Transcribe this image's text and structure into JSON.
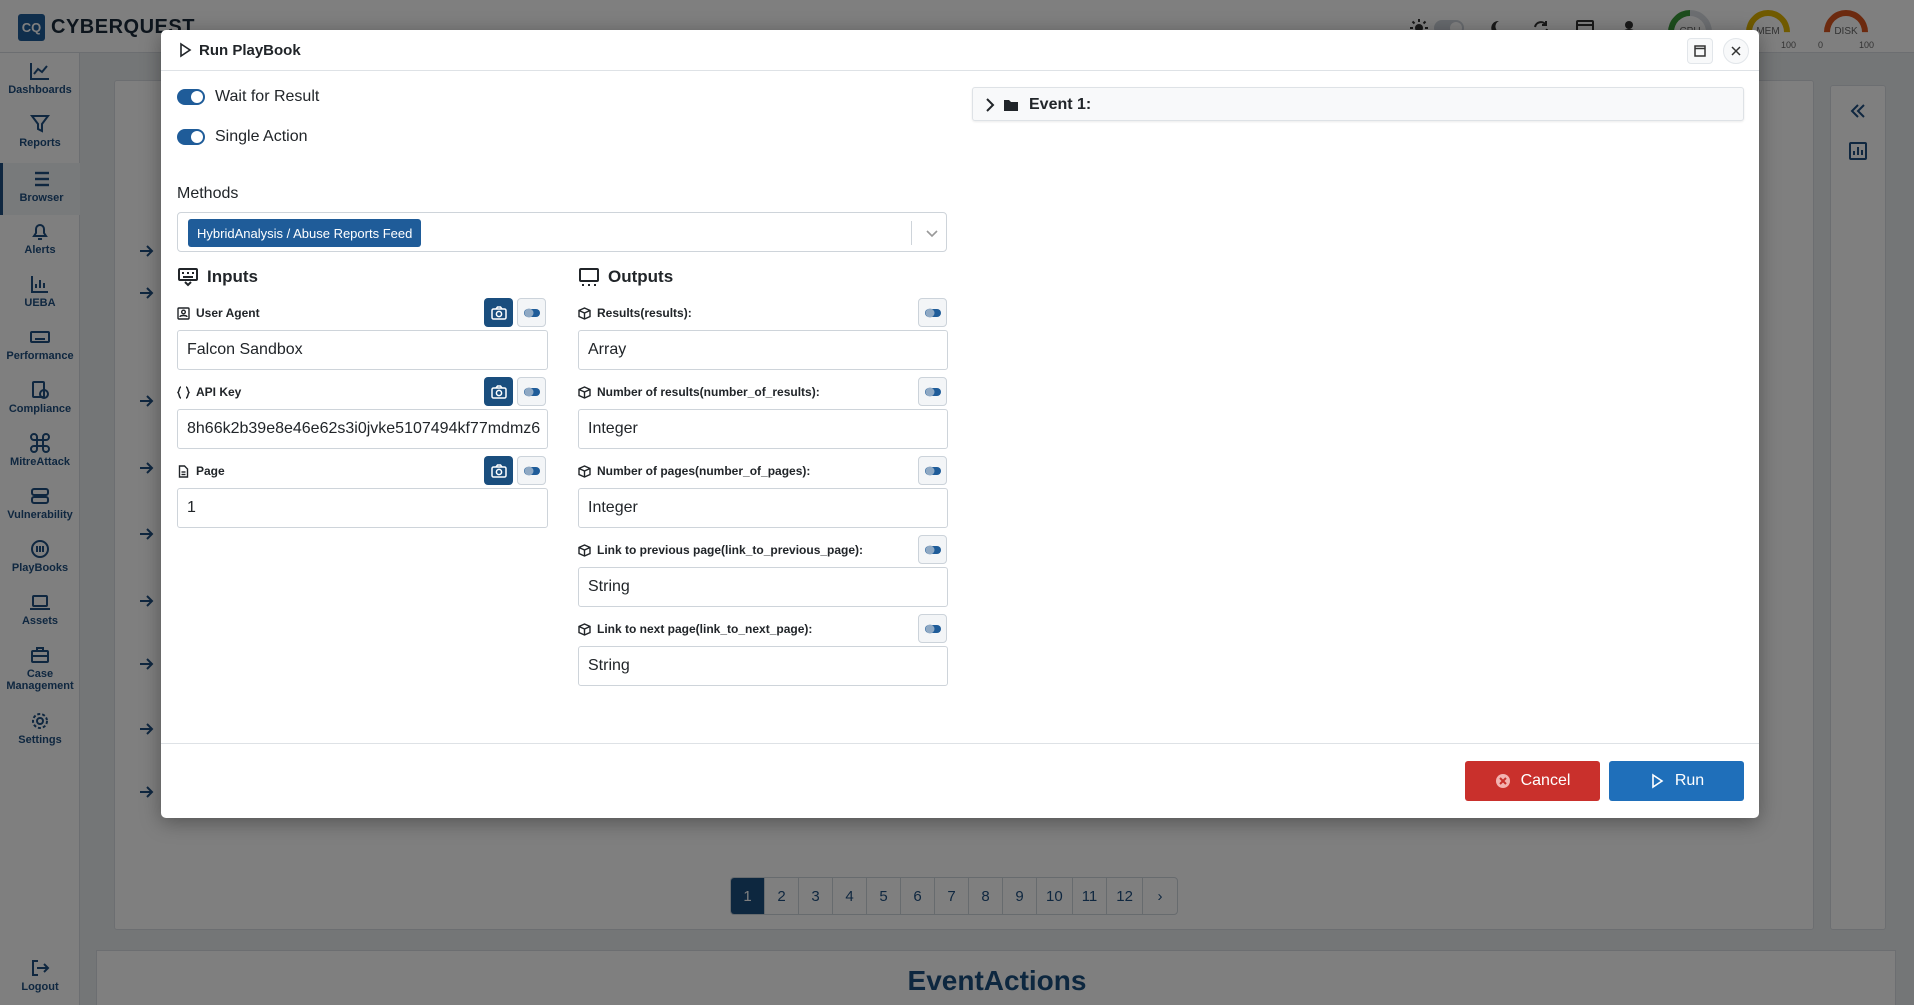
{
  "app": {
    "logo_mark": "CQ",
    "name": "CYBERQUEST"
  },
  "topbar": {
    "gauges": [
      {
        "label": "CPU",
        "min": "",
        "max": ""
      },
      {
        "label": "MEM",
        "min": "",
        "max": "100"
      },
      {
        "label": "DISK",
        "min": "0",
        "max": "100"
      }
    ]
  },
  "sidebar": {
    "items": [
      {
        "label": "Dashboards",
        "icon": "chart-line-icon"
      },
      {
        "label": "Reports",
        "icon": "filter-icon"
      },
      {
        "label": "Browser",
        "icon": "list-icon"
      },
      {
        "label": "Alerts",
        "icon": "bell-icon"
      },
      {
        "label": "UEBA",
        "icon": "chart-bar-icon"
      },
      {
        "label": "Performance",
        "icon": "keyboard-icon"
      },
      {
        "label": "Compliance",
        "icon": "file-check-icon"
      },
      {
        "label": "MitreAttack",
        "icon": "command-icon"
      },
      {
        "label": "Vulnerability",
        "icon": "server-icon"
      },
      {
        "label": "PlayBooks",
        "icon": "playbook-icon"
      },
      {
        "label": "Assets",
        "icon": "laptop-icon"
      },
      {
        "label": "Case",
        "label2": "Management",
        "icon": "briefcase-icon"
      },
      {
        "label": "Settings",
        "icon": "gear-icon"
      }
    ],
    "logout": "Logout"
  },
  "background": {
    "pagination": [
      "1",
      "2",
      "3",
      "4",
      "5",
      "6",
      "7",
      "8",
      "9",
      "10",
      "11",
      "12",
      "›"
    ],
    "bottom_title": "EventActions"
  },
  "modal": {
    "title": "Run PlayBook",
    "toggles": [
      {
        "label": "Wait for Result",
        "on": true
      },
      {
        "label": "Single Action",
        "on": true
      }
    ],
    "methods_label": "Methods",
    "methods_selected": "HybridAnalysis / Abuse Reports Feed",
    "inputs_title": "Inputs",
    "outputs_title": "Outputs",
    "inputs": [
      {
        "label": "User Agent",
        "value": "Falcon Sandbox"
      },
      {
        "label": "API Key",
        "value": "8h66k2b39e8e46e62s3i0jvke5107494kf77mdmz6"
      },
      {
        "label": "Page",
        "value": "1"
      }
    ],
    "outputs": [
      {
        "label": "Results(results):",
        "value": "Array"
      },
      {
        "label": "Number of results(number_of_results):",
        "value": "Integer"
      },
      {
        "label": "Number of pages(number_of_pages):",
        "value": "Integer"
      },
      {
        "label": "Link to previous page(link_to_previous_page):",
        "value": "String"
      },
      {
        "label": "Link to next page(link_to_next_page):",
        "value": "String"
      }
    ],
    "event_title": "Event 1:",
    "cancel_label": "Cancel",
    "run_label": "Run"
  },
  "colors": {
    "primary": "#1f5c99",
    "dark_primary": "#1a4e7e",
    "cancel": "#c9302c",
    "run": "#1f6fba"
  }
}
